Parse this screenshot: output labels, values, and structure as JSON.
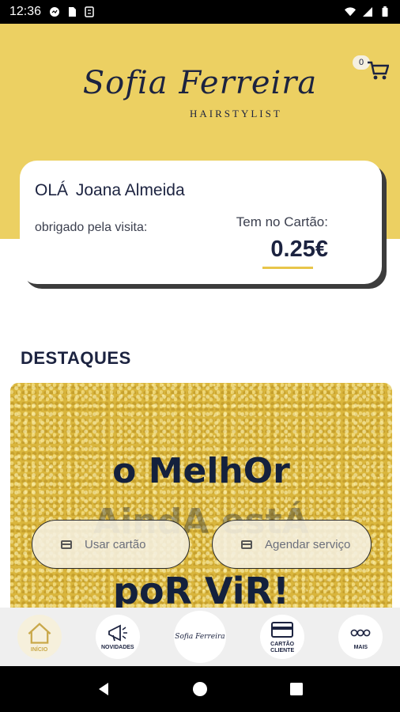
{
  "status_bar": {
    "time": "12:36",
    "left_icons": [
      "messenger-icon",
      "sim-icon",
      "sync-icon"
    ],
    "right_icons": [
      "wifi-icon",
      "signal-icon",
      "battery-icon"
    ]
  },
  "brand": {
    "script": "Sofia Ferreira",
    "subtitle": "HAIRSTYLIST",
    "accent_color": "#ecd062",
    "ink_color": "#1c2340"
  },
  "cart": {
    "count": "0",
    "icon": "cart-icon"
  },
  "card": {
    "hello": "OLÁ",
    "name": "Joana Almeida",
    "thanks": "obrigado pela visita:",
    "balance_label": "Tem no Cartão:",
    "balance_value": "0.25€"
  },
  "section": {
    "title": "DESTAQUES"
  },
  "banner": {
    "line1": "o MelhOr",
    "line2": "AindA estÁ",
    "line3": "poR ViR!"
  },
  "actions": {
    "use_card": "Usar cartão",
    "schedule": "Agendar serviço"
  },
  "nav": {
    "items": [
      {
        "label": "INÍCIO",
        "icon": "home-icon"
      },
      {
        "label": "NOVIDADES",
        "icon": "megaphone-icon"
      },
      {
        "label": "Sofia Ferreira",
        "icon": "brand-logo-icon"
      },
      {
        "label": "CARTÃO CLIENTE",
        "icon": "card-icon"
      },
      {
        "label": "MAIS",
        "icon": "more-icon"
      }
    ]
  },
  "system_nav": [
    "back-icon",
    "home-circle-icon",
    "recents-icon"
  ]
}
